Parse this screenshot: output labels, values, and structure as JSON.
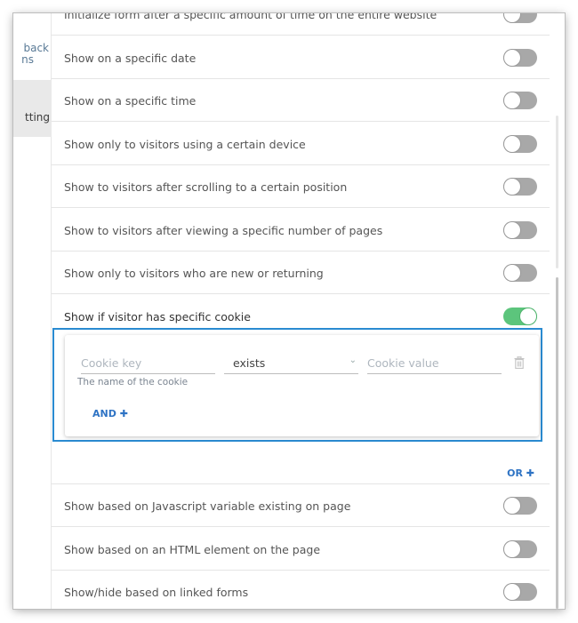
{
  "sidebar": {
    "feedback_line1": "back",
    "feedback_line2": "ns",
    "targeting": "tting"
  },
  "rows": [
    {
      "label": "Initialize form after a specific amount of time on the entire website",
      "on": false
    },
    {
      "label": "Show on a specific date",
      "on": false
    },
    {
      "label": "Show on a specific time",
      "on": false
    },
    {
      "label": "Show only to visitors using a certain device",
      "on": false
    },
    {
      "label": "Show to visitors after scrolling to a certain position",
      "on": false
    },
    {
      "label": "Show to visitors after viewing a specific number of pages",
      "on": false
    },
    {
      "label": "Show only to visitors who are new or returning",
      "on": false
    },
    {
      "label": "Show if visitor has specific cookie",
      "on": true
    }
  ],
  "cookie": {
    "key_placeholder": "Cookie key",
    "operator": "exists",
    "value_placeholder": "Cookie value",
    "helper": "The name of the cookie",
    "and_label": "AND",
    "or_label": "OR"
  },
  "rows_after": [
    {
      "label": "Show based on Javascript variable existing on page",
      "on": false
    },
    {
      "label": "Show based on an HTML element on the page",
      "on": false
    },
    {
      "label": "Show/hide based on linked forms",
      "on": false
    }
  ]
}
